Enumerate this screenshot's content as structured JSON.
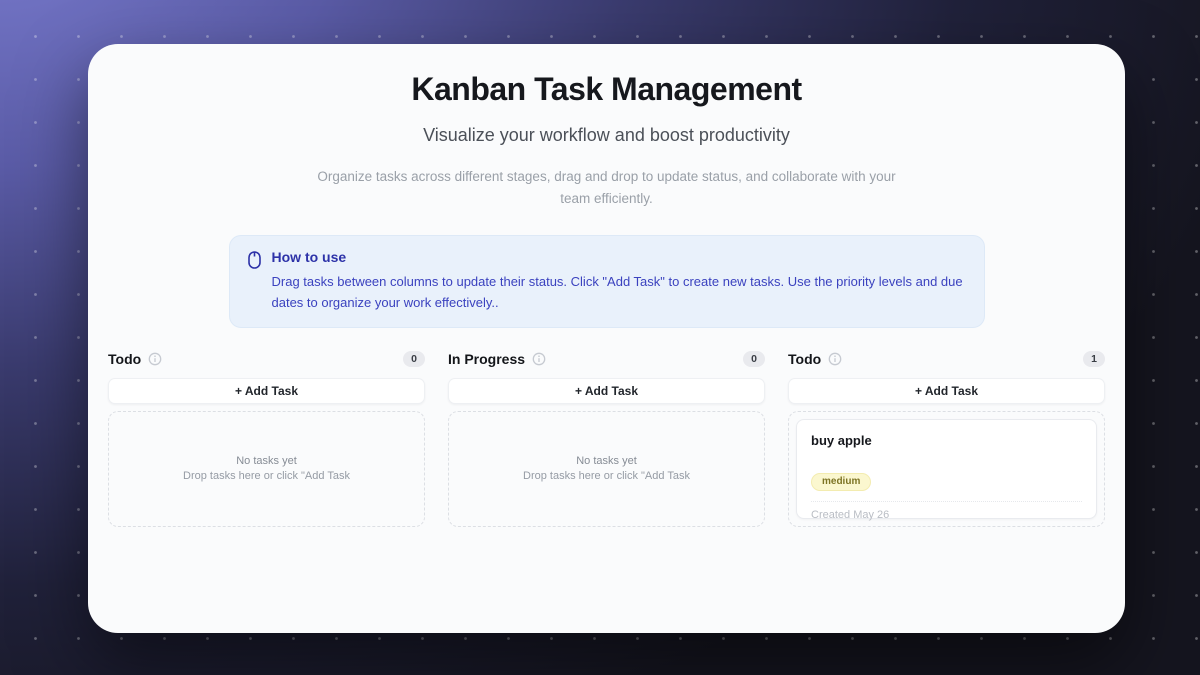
{
  "page": {
    "title": "Kanban Task Management",
    "subtitle": "Visualize your workflow and boost productivity",
    "description": "Organize tasks across different stages, drag and drop to update status, and collaborate with your team efficiently."
  },
  "how_to_use": {
    "icon": "mouse-icon",
    "title": "How to use",
    "body": "Drag tasks between columns to update their status. Click \"Add Task\" to create new tasks. Use the priority levels and due dates to organize your work effectively.."
  },
  "columns": [
    {
      "title": "Todo",
      "info_icon": "info-icon",
      "count": "0",
      "add_task_label": "+ Add Task",
      "empty_title": "No tasks yet",
      "empty_subtitle": "Drop tasks here or click \"Add Task"
    },
    {
      "title": "In Progress",
      "info_icon": "info-icon",
      "count": "0",
      "add_task_label": "+ Add Task",
      "empty_title": "No tasks yet",
      "empty_subtitle": "Drop tasks here or click \"Add Task"
    },
    {
      "title": "Todo",
      "info_icon": "info-icon",
      "count": "1",
      "add_task_label": "+ Add Task",
      "task": {
        "title": "buy apple",
        "priority": "medium",
        "created": "Created May 26"
      }
    }
  ],
  "colors": {
    "accent_indigo": "#2d32a8",
    "howto_panel_bg": "#e9f1fb",
    "priority_medium_bg": "#fbf7cf",
    "priority_medium_text": "#7d7425",
    "count_badge_bg": "#e9eaee",
    "background_purple": "#7678ca",
    "background_dark": "#15151f",
    "card_bg": "#fafbfc"
  }
}
